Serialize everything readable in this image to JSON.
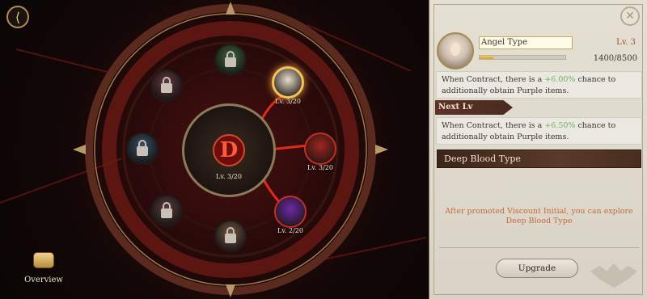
{
  "scene": {
    "back_icon": "back-arrow-icon",
    "overview": {
      "label": "Overview",
      "icon": "scroll-book-icon"
    },
    "center": {
      "glyph": "D",
      "level": "Lv. 3/20"
    },
    "nodes": [
      {
        "id": "top",
        "level": "",
        "state": "locked",
        "color": "#3f8e3f"
      },
      {
        "id": "top-right",
        "level": "Lv. 3/20",
        "state": "selected",
        "color": "#e9dcc8"
      },
      {
        "id": "right",
        "level": "Lv. 3/20",
        "state": "unlocked",
        "color": "#a0251f"
      },
      {
        "id": "bottom-right",
        "level": "Lv. 2/20",
        "state": "unlocked",
        "color": "#6b2aa5"
      },
      {
        "id": "bottom",
        "level": "",
        "state": "locked",
        "color": "#b06b46"
      },
      {
        "id": "bottom-left",
        "level": "",
        "state": "locked",
        "color": "#8a4a55"
      },
      {
        "id": "left",
        "level": "",
        "state": "locked",
        "color": "#3f6ea0"
      },
      {
        "id": "top-left",
        "level": "",
        "state": "locked",
        "color": "#a24257"
      }
    ]
  },
  "panel": {
    "close_icon": "close-icon",
    "type_name": "Angel Type",
    "level": "Lv. 3",
    "xp_text": "1400/8500",
    "xp_progress": 0.165,
    "current_effect": {
      "prefix": "When Contract, there is a ",
      "value": "+6.00%",
      "suffix": " chance to additionally obtain Purple items."
    },
    "next_header": "Next Lv",
    "next_effect": {
      "prefix": "When Contract, there is a ",
      "value": "+6.50%",
      "suffix": " chance to additionally obtain Purple items."
    },
    "next_type": "Deep Blood Type",
    "unlock_hint": "After promoted  Viscount Initial, you can explore Deep Blood Type",
    "upgrade_label": "Upgrade",
    "accent_color": "#6fb35b",
    "hint_color": "#c46a3a"
  }
}
